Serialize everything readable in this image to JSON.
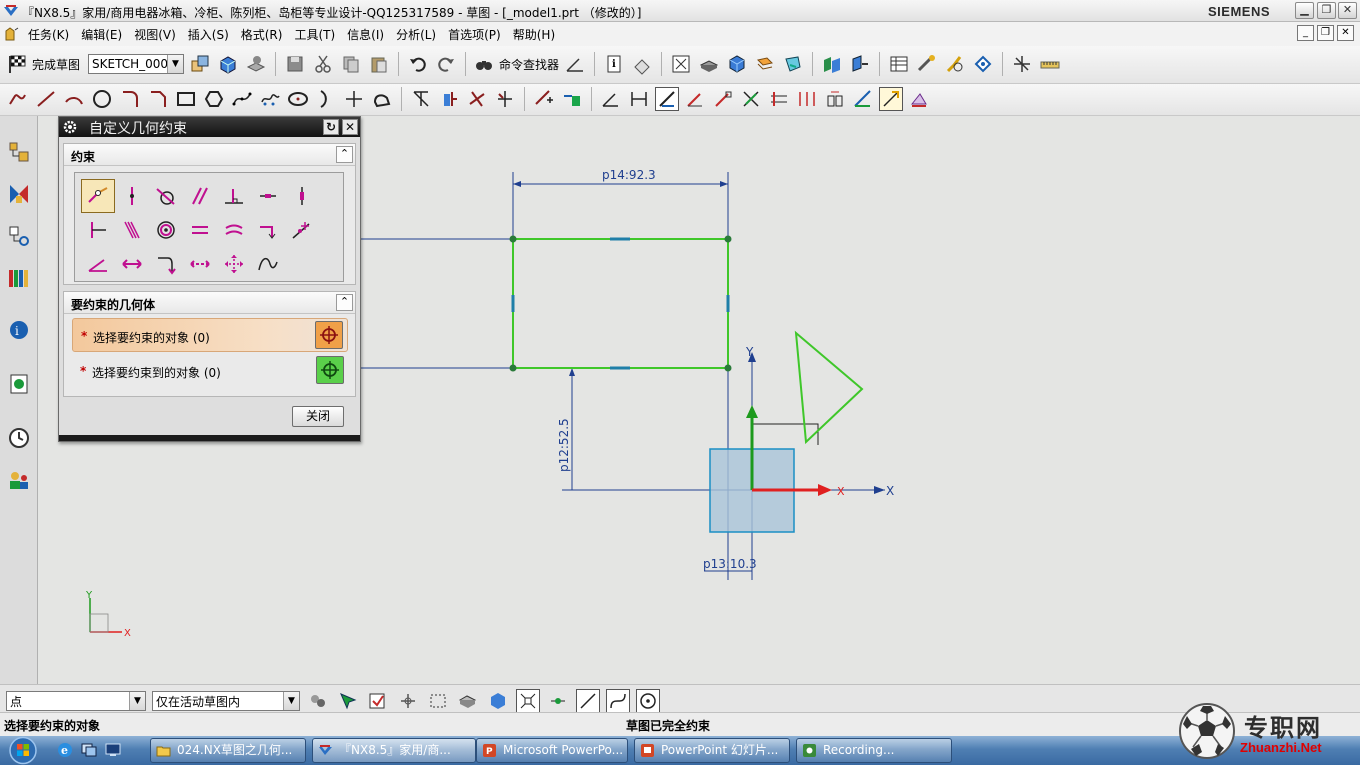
{
  "window": {
    "title": "『NX8.5』家用/商用电器冰箱、冷柜、陈列柜、岛柜等专业设计-QQ125317589 - 草图 - [_model1.prt （修改的）]",
    "brand": "SIEMENS"
  },
  "menu": {
    "items": [
      "任务(K)",
      "编辑(E)",
      "视图(V)",
      "插入(S)",
      "格式(R)",
      "工具(T)",
      "信息(I)",
      "分析(L)",
      "首选项(P)",
      "帮助(H)"
    ]
  },
  "toolbar": {
    "finish_sketch": "完成草图",
    "sketch_name": "SKETCH_000",
    "command_finder": "命令查找器"
  },
  "dialog": {
    "title": "自定义几何约束",
    "constraints_group": "约束",
    "geometry_group": "要约束的几何体",
    "select_objects": "选择要约束的对象 (0)",
    "select_target": "选择要约束到的对象 (0)",
    "close_label": "关闭"
  },
  "sketch": {
    "dim_horizontal": "p14:92.3",
    "dim_vertical": "p12:52.5",
    "dim_small": "p13:10.3",
    "axis_x": "X",
    "axis_y": "Y"
  },
  "selection_bar": {
    "filter": "点",
    "scope": "仅在活动草图内"
  },
  "status": {
    "prompt": "选择要约束的对象",
    "message": "草图已完全约束"
  },
  "taskbar": {
    "tasks": [
      "024.NX草图之几何...",
      "『NX8.5』家用/商...",
      "Microsoft PowerPo...",
      "PowerPoint 幻灯片...",
      "Recording..."
    ]
  },
  "watermark": {
    "text": "专职网",
    "url": "Zhuanzhi.Net"
  },
  "colors": {
    "sketch_green": "#3fc72a",
    "dim_blue": "#1f3f8f",
    "axis_red": "#e02020",
    "axis_green": "#1d9a1d",
    "datum_blue": "#7fa9c9"
  }
}
